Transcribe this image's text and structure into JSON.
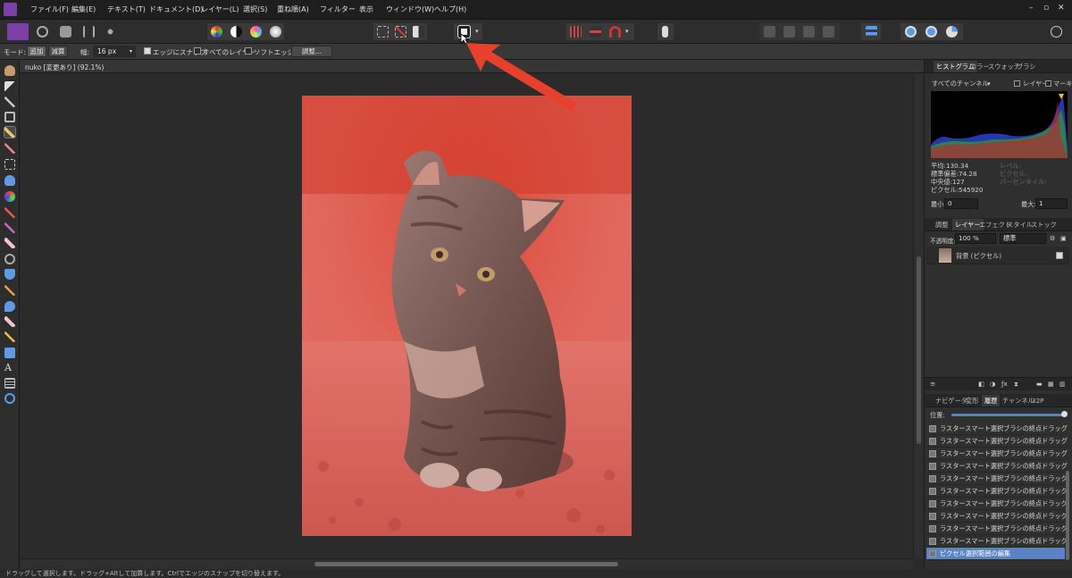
{
  "menu": [
    "ファイル(F)",
    "編集(E)",
    "テキスト(T)",
    "ドキュメント(D)",
    "レイヤー(L)",
    "選択(S)",
    "重ね順(A)",
    "フィルター",
    "表示",
    "ウィンドウ(W)",
    "ヘルプ(H)"
  ],
  "window_controls": [
    "–",
    "▫",
    "✕"
  ],
  "context_bar": {
    "mode_label": "モード:",
    "mode_add": "追加",
    "mode_subtract": "減算",
    "width_label": "幅:",
    "width_value": "16 px",
    "snap_edges": "エッジにスナップ",
    "all_layers": "すべてのレイヤー",
    "soft_edge": "ソフトエッジ",
    "adjust_button": "調整..."
  },
  "document": {
    "tab_title": "nuko [変更あり] (92.1%)"
  },
  "histogram_panel": {
    "tabs": [
      "ヒストグラム",
      "カラー",
      "スウォッチ",
      "ブラシ"
    ],
    "channel_select": "すべてのチャンネル",
    "layer_check": "レイヤー",
    "marquee_check": "マーキー",
    "stats": [
      {
        "label": "平均:",
        "value": "130.34"
      },
      {
        "label": "標準偏差:",
        "value": "74.28"
      },
      {
        "label": "中央値:",
        "value": "127"
      },
      {
        "label": "ピクセル:",
        "value": "545920"
      }
    ],
    "stats_right": [
      "レベル:",
      "ピクセル:",
      "パーセンタイル:"
    ],
    "min_label": "最小:",
    "min_value": "0",
    "max_label": "最大:",
    "max_value": "1"
  },
  "layers_panel": {
    "tabs": [
      "調整",
      "レイヤー",
      "エフェクト",
      "スタイル",
      "ストック"
    ],
    "opacity_label": "不透明度:",
    "opacity_value": "100 %",
    "blend_mode": "標準",
    "layer_name": "背景 (ピクセル)"
  },
  "history_panel": {
    "tabs": [
      "ナビゲータ",
      "変形",
      "履歴",
      "チャンネル",
      "32P"
    ],
    "position_label": "位置:",
    "items": [
      "ラスタースマート選択ブラシの終点ドラッグ",
      "ラスタースマート選択ブラシの終点ドラッグ",
      "ラスタースマート選択ブラシの終点ドラッグ",
      "ラスタースマート選択ブラシの終点ドラッグ",
      "ラスタースマート選択ブラシの終点ドラッグ",
      "ラスタースマート選択ブラシの終点ドラッグ",
      "ラスタースマート選択ブラシの終点ドラッグ",
      "ラスタースマート選択ブラシの終点ドラッグ",
      "ラスタースマート選択ブラシの終点ドラッグ",
      "ラスタースマート選択ブラシの終点ドラッグ"
    ],
    "selected_item": "ピクセル選択範囲の編集"
  },
  "status": "ドラッグして選択します。ドラッグ+Altして加算します。Ctrlでエッジのスナップを切り替えます。",
  "colors": {
    "accent": "#5b82c8",
    "arrow": "#e8412b",
    "selection_tint": "#e2504a"
  }
}
